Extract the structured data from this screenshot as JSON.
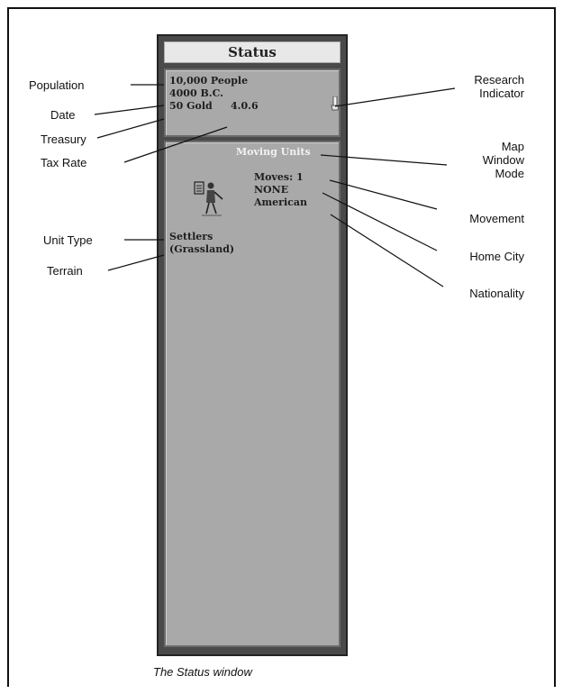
{
  "window": {
    "title": "Status",
    "stats": {
      "population": "10,000 People",
      "date": "4000 B.C.",
      "treasury": "50 Gold",
      "tax_rate": "4.0.6"
    },
    "unit": {
      "mode": "Moving Units",
      "moves": "Moves: 1",
      "home_city": "NONE",
      "nationality": "American",
      "type": "Settlers",
      "terrain": "(Grassland)"
    },
    "icons": [
      "research-flask-icon",
      "settlers-unit-icon"
    ]
  },
  "callouts": {
    "population": "Population",
    "date": "Date",
    "treasury": "Treasury",
    "tax_rate": "Tax Rate",
    "unit_type": "Unit Type",
    "terrain": "Terrain",
    "research_line1": "Research",
    "research_line2": "Indicator",
    "map_line1": "Map",
    "map_line2": "Window",
    "map_line3": "Mode",
    "movement": "Movement",
    "home_city": "Home City",
    "nationality": "Nationality"
  },
  "caption": "The Status window"
}
